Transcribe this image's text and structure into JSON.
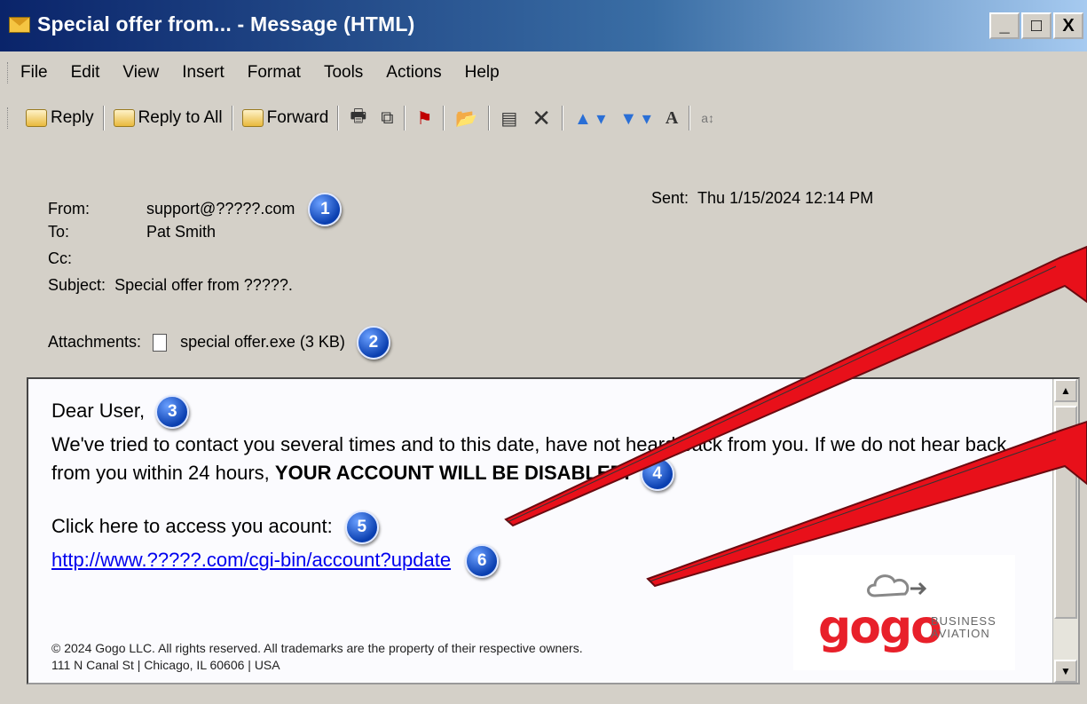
{
  "window": {
    "title": "Special offer from... - Message (HTML)",
    "controls": [
      "_",
      "□",
      "X"
    ]
  },
  "menu": [
    "File",
    "Edit",
    "View",
    "Insert",
    "Format",
    "Tools",
    "Actions",
    "Help"
  ],
  "toolbar": {
    "reply": "Reply",
    "reply_all": "Reply to All",
    "forward": "Forward"
  },
  "header": {
    "from_label": "From:",
    "from_value": "support@?????.com",
    "to_label": "To:",
    "to_value": "Pat Smith",
    "cc_label": "Cc:",
    "subject_label": "Subject:",
    "subject_value": "Special offer from ?????.",
    "sent_label": "Sent:",
    "sent_value": "Thu 1/15/2024 12:14 PM",
    "attachments_label": "Attachments:",
    "attachment_name": "special offer.exe (3 KB)"
  },
  "markers": [
    "1",
    "2",
    "3",
    "4",
    "5",
    "6"
  ],
  "body": {
    "greeting": "Dear User,",
    "para1": "We've tried to contact you several times and to this date, have not heard back from you. If we do not hear back from you within 24 hours,",
    "para1_bold": "YOUR ACCOUNT WILL BE DISABLED.",
    "cta": "Click here to access you acount:",
    "link": "http://www.?????.com/cgi-bin/account?update",
    "footer_line1": "© 2024 Gogo LLC. All rights reserved. All trademarks are the property of their respective owners.",
    "footer_line2": "111 N Canal St | Chicago, IL 60606 | USA"
  },
  "logo": {
    "brand": "gogo",
    "tagline_1": "BUSINESS",
    "tagline_2": "AVIATION"
  },
  "colors": {
    "titlebar": "#0a246a",
    "chrome": "#d4d0c8",
    "marker": "#0a3fb0",
    "arrow": "#e8101a",
    "link": "#0000ee"
  }
}
